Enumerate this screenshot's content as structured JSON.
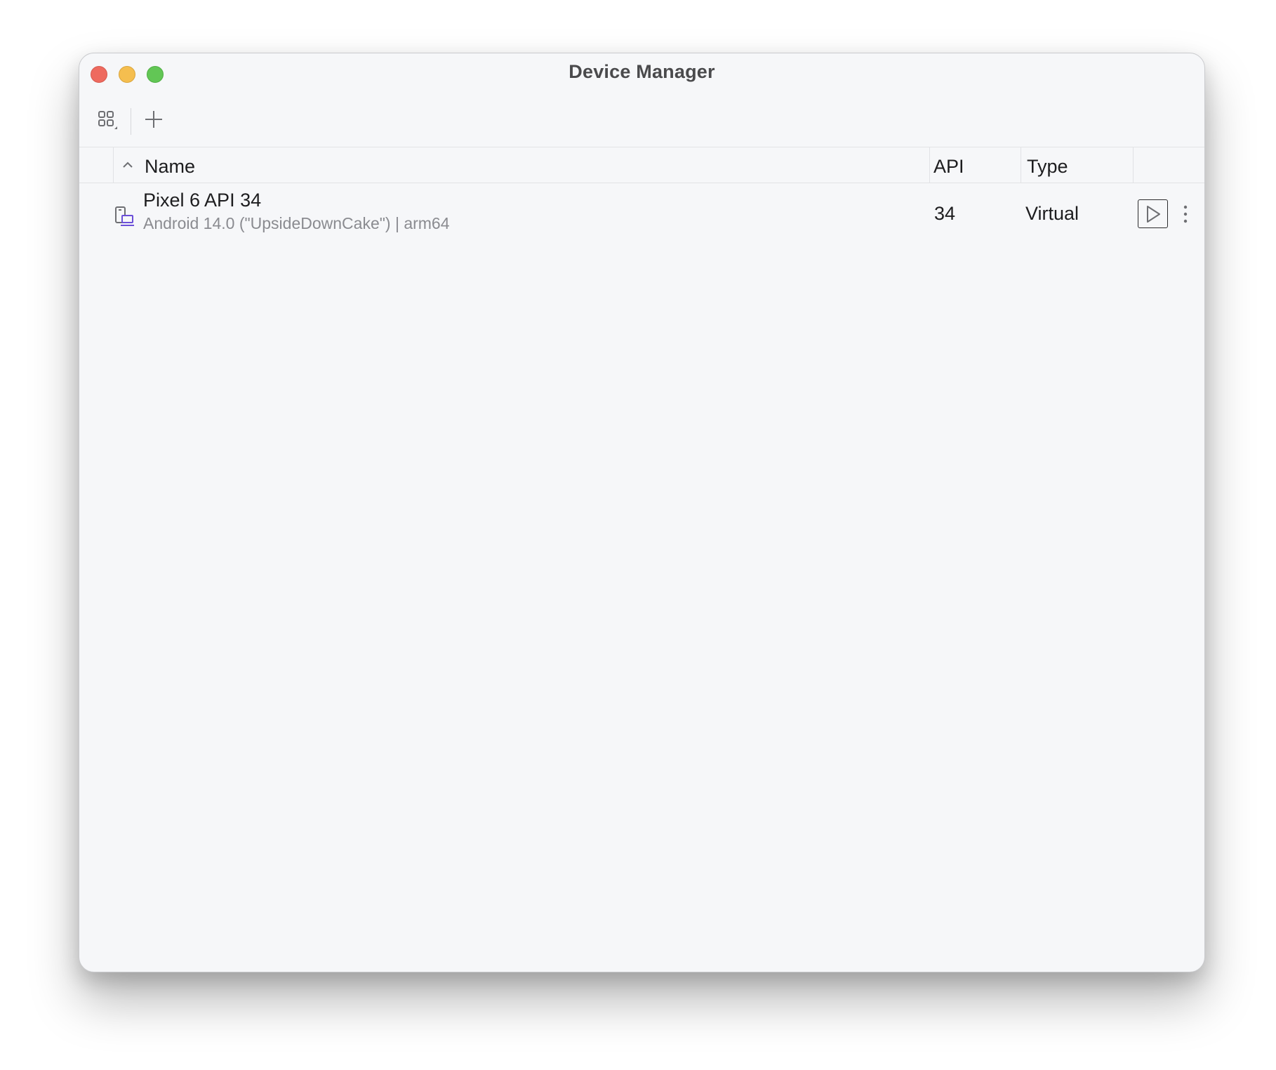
{
  "window": {
    "title": "Device Manager"
  },
  "toolbar": {
    "view_toggle_icon": "grid-view-icon",
    "add_icon": "plus-icon"
  },
  "table": {
    "columns": [
      {
        "label": "Name",
        "sort": "ascending"
      },
      {
        "label": "API"
      },
      {
        "label": "Type"
      }
    ],
    "rows": [
      {
        "icon": "virtual-device-icon",
        "name": "Pixel 6 API 34",
        "details": "Android 14.0 (\"UpsideDownCake\") | arm64",
        "api": "34",
        "type": "Virtual",
        "actions": [
          "run-icon",
          "more-vertical-icon"
        ]
      }
    ]
  },
  "colors": {
    "window_bg": "#f6f7f9",
    "close": "#ee6a5f",
    "minimize": "#f5be4f",
    "zoom": "#62c655",
    "device_icon_accent": "#6b4fd8"
  }
}
